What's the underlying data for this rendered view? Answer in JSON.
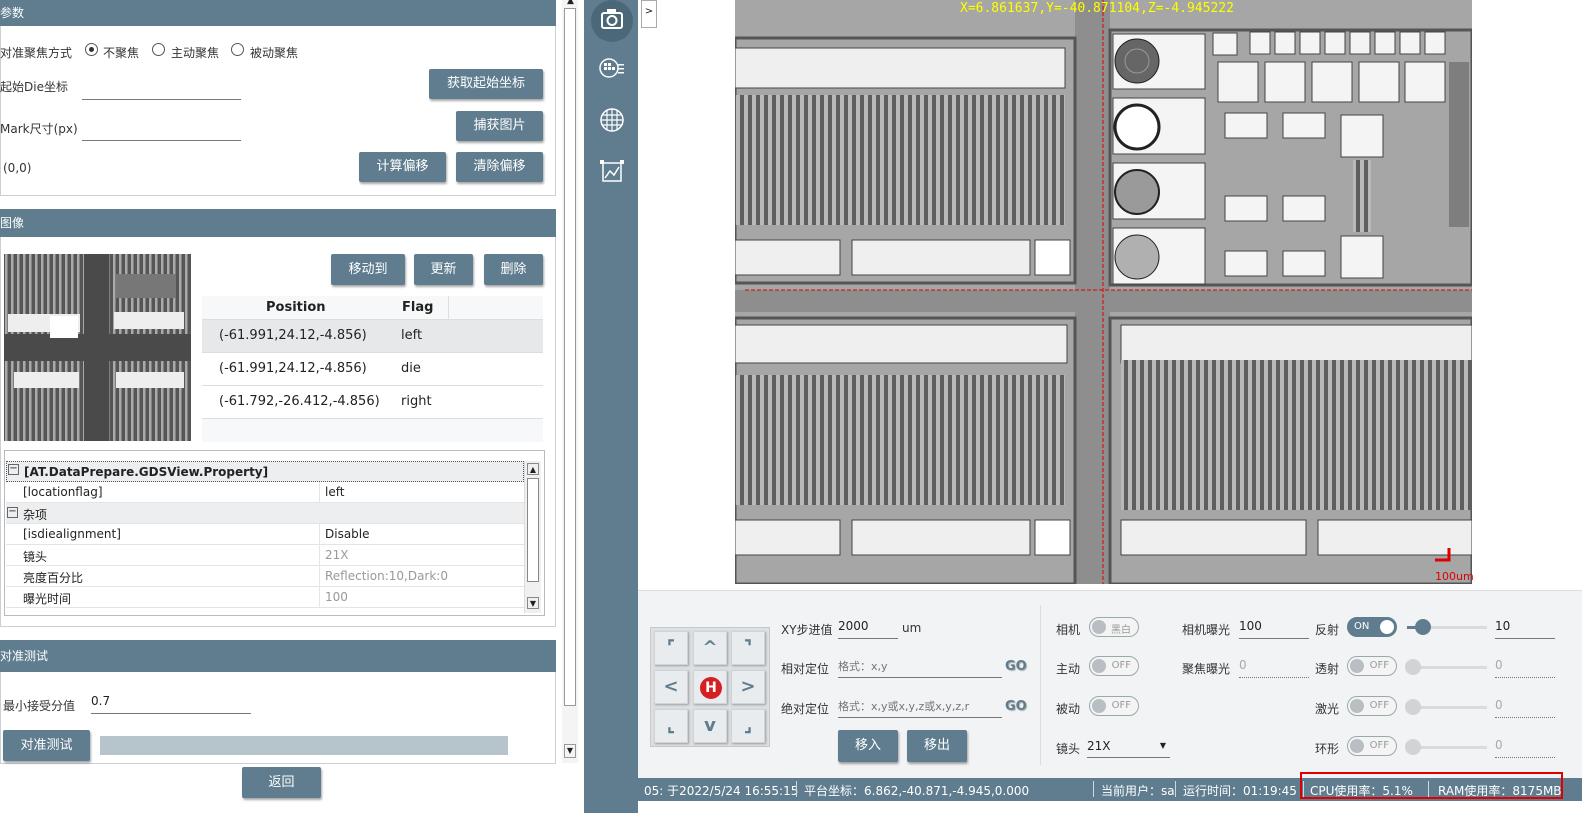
{
  "params": {
    "title": "参数",
    "focus_label": "对准聚焦方式",
    "focus_options": [
      "不聚焦",
      "主动聚焦",
      "被动聚焦"
    ],
    "start_die_label": "起始Die坐标",
    "start_die_value": "",
    "get_start_btn": "获取起始坐标",
    "mark_size_label": "Mark尺寸(px)",
    "mark_size_value": "",
    "capture_btn": "捕获图片",
    "offset_value": "(0,0)",
    "calc_offset_btn": "计算偏移",
    "clear_offset_btn": "清除偏移"
  },
  "image": {
    "title": "图像",
    "move_to_btn": "移动到",
    "update_btn": "更新",
    "delete_btn": "删除",
    "columns": [
      "Position",
      "Flag"
    ],
    "rows": [
      {
        "position": "(-61.991,24.12,-4.856)",
        "flag": "left"
      },
      {
        "position": "(-61.991,24.12,-4.856)",
        "flag": "die"
      },
      {
        "position": "(-61.792,-26.412,-4.856)",
        "flag": "right"
      }
    ]
  },
  "property_grid": {
    "category1": "[AT.DataPrepare.GDSView.Property]",
    "rows1": [
      {
        "key": "[locationflag]",
        "value": "left"
      }
    ],
    "category2": "杂项",
    "rows2": [
      {
        "key": "[isdiealignment]",
        "value": "Disable"
      },
      {
        "key": "镜头",
        "value": "21X"
      },
      {
        "key": "亮度百分比",
        "value": "Reflection:10,Dark:0"
      },
      {
        "key": "曝光时间",
        "value": "100"
      }
    ]
  },
  "align_test": {
    "title": "对准测试",
    "min_score_label": "最小接受分值",
    "min_score_value": "0.7",
    "test_btn": "对准测试",
    "back_btn": "返回"
  },
  "side_icons": [
    "camera-icon",
    "map-grid-icon",
    "wafer-grid-icon",
    "image-chart-icon"
  ],
  "collapse_label": ">",
  "viewer": {
    "coord_readout": "X=6.861637,Y=-40.871104,Z=-4.945222",
    "scale_label": "100um"
  },
  "controls": {
    "home_label": "H",
    "xy_step_label": "XY步进值",
    "xy_step_value": "2000",
    "xy_step_unit": "um",
    "rel_pos_label": "相对定位",
    "rel_pos_placeholder": "格式：x,y",
    "abs_pos_label": "绝对定位",
    "abs_pos_placeholder": "格式：x,y或x,y,z或x,y,z,r",
    "go_label": "GO",
    "move_in_btn": "移入",
    "move_out_btn": "移出",
    "camera_label": "相机",
    "camera_toggle": "黑白",
    "active_label": "主动",
    "active_toggle": "OFF",
    "passive_label": "被动",
    "passive_toggle": "OFF",
    "lens_label": "镜头",
    "lens_value": "21X",
    "cam_exposure_label": "相机曝光",
    "cam_exposure_value": "100",
    "focus_exposure_label": "聚焦曝光",
    "focus_exposure_value": "0",
    "reflect_label": "反射",
    "reflect_toggle": "ON",
    "reflect_value": "10",
    "transmit_label": "透射",
    "transmit_toggle": "OFF",
    "transmit_value": "0",
    "laser_label": "激光",
    "laser_toggle": "OFF",
    "laser_value": "0",
    "ring_label": "环形",
    "ring_toggle": "OFF",
    "ring_value": "0",
    "reflect_level": 0.2
  },
  "status": {
    "log": "05: 于2022/5/24 16:55:15",
    "platform": "平台坐标：6.862,-40.871,-4.945,0.000",
    "user": "当前用户：sa",
    "runtime": "运行时间：01:19:45",
    "cpu": "CPU使用率：5.1%",
    "ram": "RAM使用率：8175MB"
  },
  "colors": {
    "accent": "#5f7d8f",
    "highlight": "#e00000",
    "readout": "#ffff00"
  }
}
